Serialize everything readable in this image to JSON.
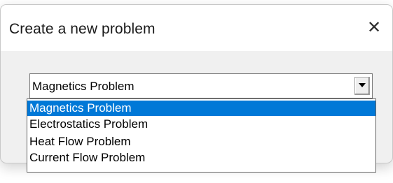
{
  "dialog": {
    "title": "Create a new problem",
    "close_glyph": "✕"
  },
  "combo": {
    "value": "Magnetics Problem",
    "arrow_icon": "dropdown-arrow-icon"
  },
  "dropdown": {
    "options": [
      "Magnetics Problem",
      "Electrostatics Problem",
      "Heat Flow Problem",
      "Current Flow Problem"
    ],
    "selected_index": 0
  },
  "colors": {
    "selection": "#0078d7",
    "dialog_body": "#f0f0f0",
    "titlebar": "#ffffff"
  }
}
